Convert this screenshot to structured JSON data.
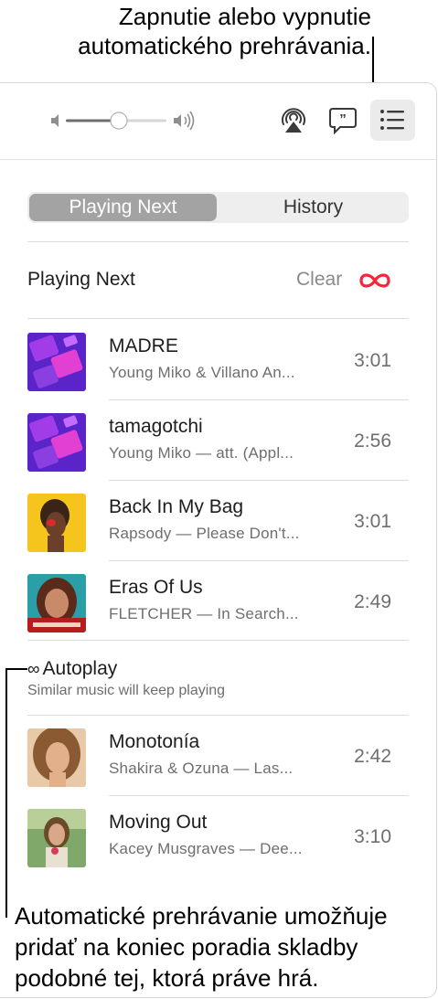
{
  "callouts": {
    "top_line1": "Zapnutie alebo vypnutie",
    "top_line2": "automatického prehrávania.",
    "bottom_line1": "Automatické prehrávanie umožňuje",
    "bottom_line2": "pridať na koniec poradia skladby",
    "bottom_line3": "podobné tej, ktorá práve hrá."
  },
  "toolbar": {
    "volume_level": 0.42,
    "icons": [
      "speaker-low-icon",
      "speaker-high-icon",
      "airplay-icon",
      "lyrics-icon",
      "queue-list-icon"
    ]
  },
  "tabs": [
    {
      "label": "Playing Next",
      "selected": true
    },
    {
      "label": "History",
      "selected": false
    }
  ],
  "queue": {
    "title": "Playing Next",
    "clear_label": "Clear",
    "autoplay_glyph": "∞",
    "tracks": [
      {
        "title": "MADRE",
        "subtitle": "Young Miko & Villano An...",
        "duration": "3:01",
        "art": "purple-collage"
      },
      {
        "title": "tamagotchi",
        "subtitle": "Young Miko — att. (Appl...",
        "duration": "2:56",
        "art": "purple-collage"
      },
      {
        "title": "Back In My Bag",
        "subtitle": "Rapsody — Please Don't...",
        "duration": "3:01",
        "art": "yellow-portrait"
      },
      {
        "title": "Eras Of Us",
        "subtitle": "FLETCHER — In Search...",
        "duration": "2:49",
        "art": "antidote-cover"
      }
    ]
  },
  "autoplay": {
    "glyph": "∞",
    "title": "Autoplay",
    "subtitle": "Similar music will keep playing",
    "tracks": [
      {
        "title": "Monotonía",
        "subtitle": "Shakira & Ozuna — Las...",
        "duration": "2:42",
        "art": "warm-portrait"
      },
      {
        "title": "Moving Out",
        "subtitle": "Kacey Musgraves — Dee...",
        "duration": "3:10",
        "art": "green-portrait"
      }
    ]
  },
  "colors": {
    "accent": "#fa233b",
    "selected_tab": "#a3a3a3",
    "secondary_text": "#6e6e6e"
  }
}
